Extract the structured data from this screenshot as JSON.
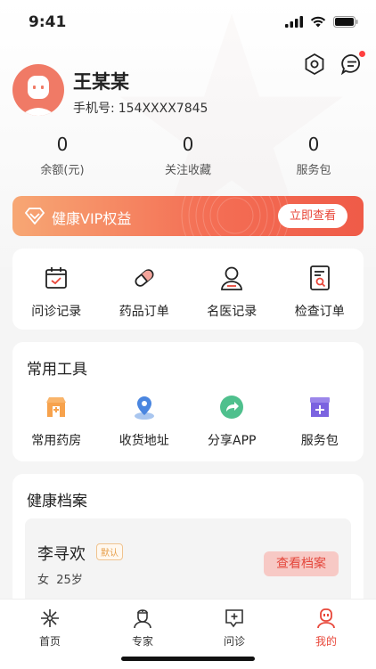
{
  "status_bar": {
    "time": "9:41"
  },
  "user": {
    "name": "王某某",
    "phone_label": "手机号:",
    "phone": "154XXXX7845"
  },
  "stats": [
    {
      "value": "0",
      "label": "余额(元)"
    },
    {
      "value": "0",
      "label": "关注收藏"
    },
    {
      "value": "0",
      "label": "服务包"
    }
  ],
  "vip": {
    "title": "健康VIP权益",
    "button": "立即查看"
  },
  "records_menu": [
    {
      "label": "问诊记录",
      "icon": "calendar-check-icon"
    },
    {
      "label": "药品订单",
      "icon": "pill-icon"
    },
    {
      "label": "名医记录",
      "icon": "doctor-icon"
    },
    {
      "label": "检查订单",
      "icon": "report-search-icon"
    }
  ],
  "tools": {
    "title": "常用工具",
    "items": [
      {
        "label": "常用药房",
        "icon": "pharmacy-icon"
      },
      {
        "label": "收货地址",
        "icon": "location-pin-icon"
      },
      {
        "label": "分享APP",
        "icon": "share-icon"
      },
      {
        "label": "服务包",
        "icon": "service-box-icon"
      }
    ]
  },
  "health": {
    "title": "健康档案",
    "record": {
      "name": "李寻欢",
      "tag": "默认",
      "gender": "女",
      "age": "25岁",
      "button": "查看档案"
    }
  },
  "tabbar": [
    {
      "label": "首页",
      "icon": "home-icon"
    },
    {
      "label": "专家",
      "icon": "expert-icon"
    },
    {
      "label": "问诊",
      "icon": "consult-icon"
    },
    {
      "label": "我的",
      "icon": "profile-icon"
    }
  ],
  "colors": {
    "accent": "#e8473a",
    "vip_start": "#f7a774",
    "vip_end": "#ef5b48"
  }
}
